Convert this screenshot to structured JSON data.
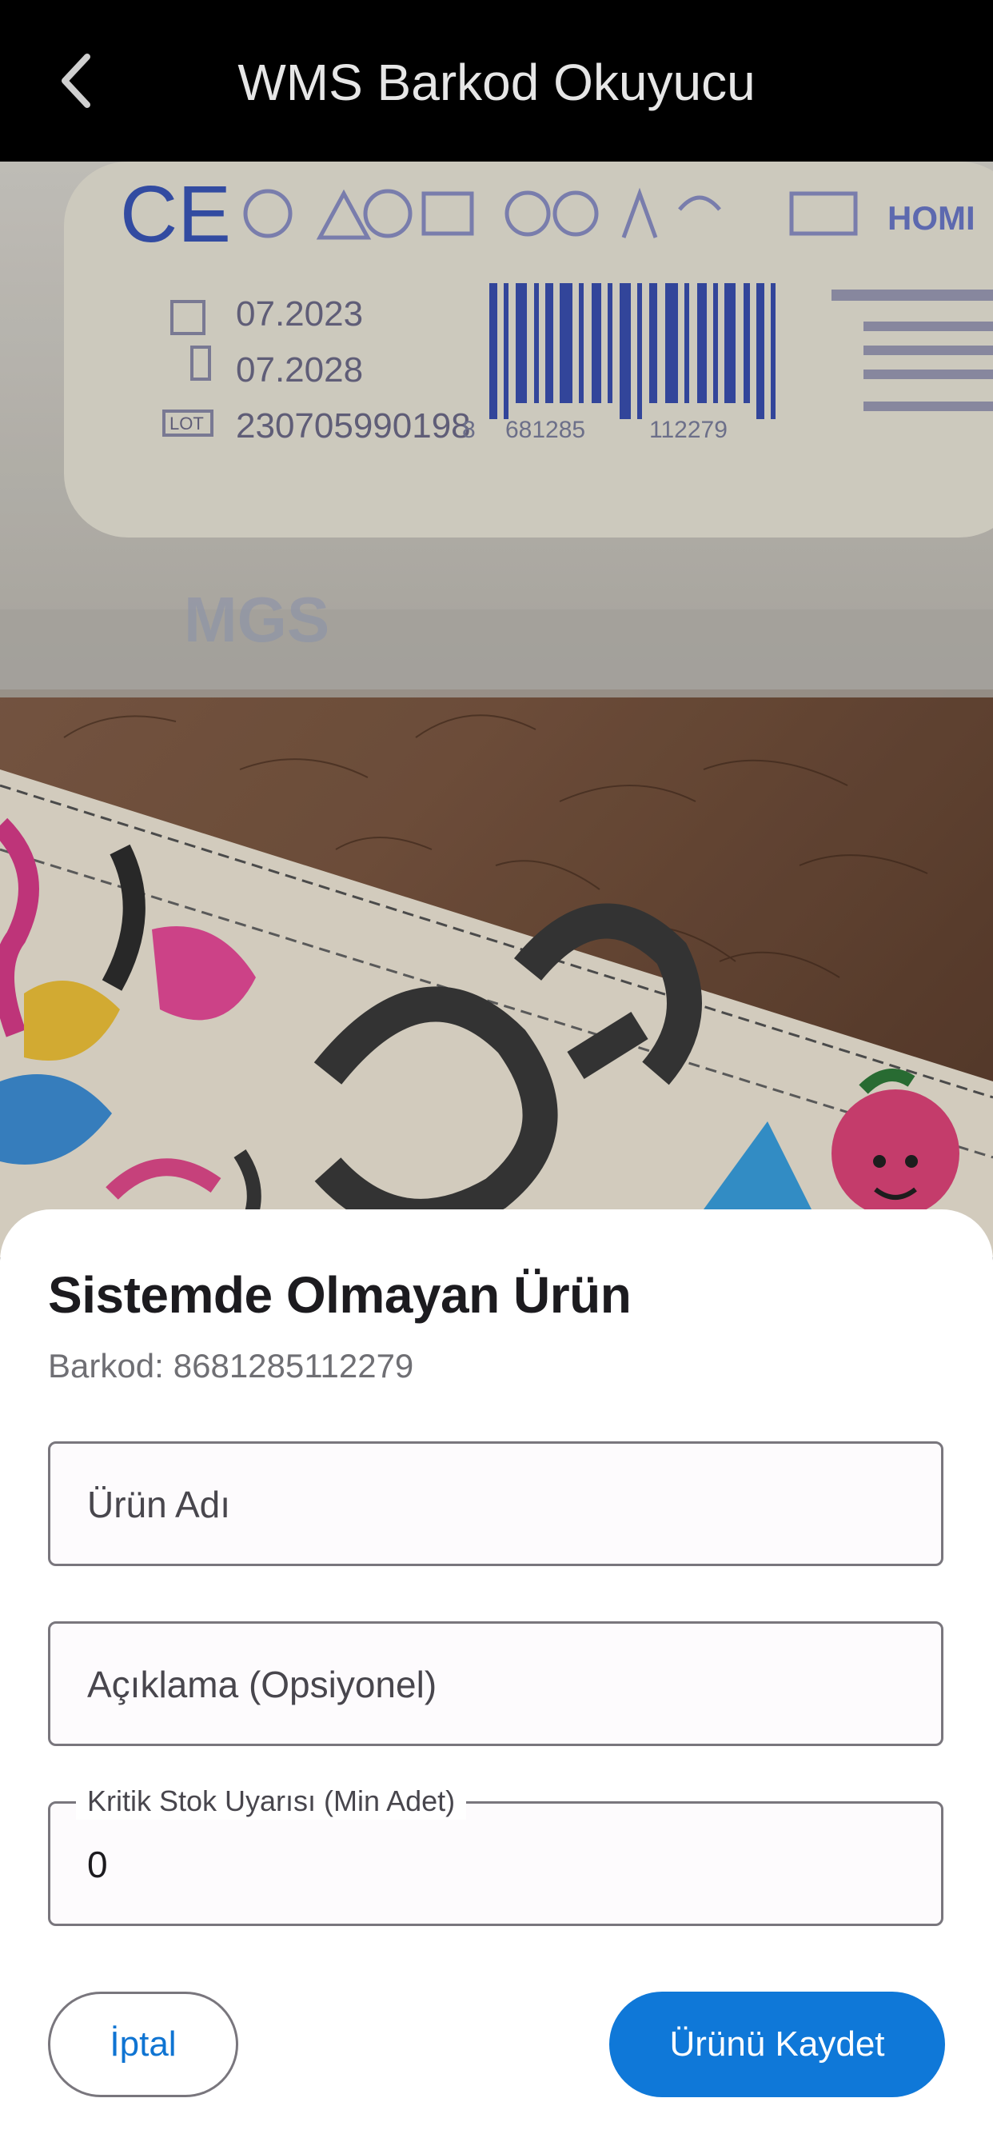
{
  "header": {
    "title": "WMS Barkod Okuyucu",
    "back_icon": "chevron-left-icon"
  },
  "camera": {
    "label_dates": [
      "07.2023",
      "07.2028"
    ],
    "label_lot": "230705990198",
    "label_lot_tag": "LOT",
    "barcode_digits": [
      "8",
      "681285",
      "112279"
    ]
  },
  "sheet": {
    "title": "Sistemde Olmayan Ürün",
    "barcode_label": "Barkod:",
    "barcode_value": "8681285112279",
    "product_name_placeholder": "Ürün Adı",
    "description_placeholder": "Açıklama (Opsiyonel)",
    "min_stock_label": "Kritik Stok Uyarısı (Min Adet)",
    "min_stock_value": "0",
    "cancel_label": "İptal",
    "save_label": "Ürünü Kaydet"
  },
  "colors": {
    "primary": "#0f78d8",
    "link": "#0f74d2",
    "outline": "#79767d"
  }
}
